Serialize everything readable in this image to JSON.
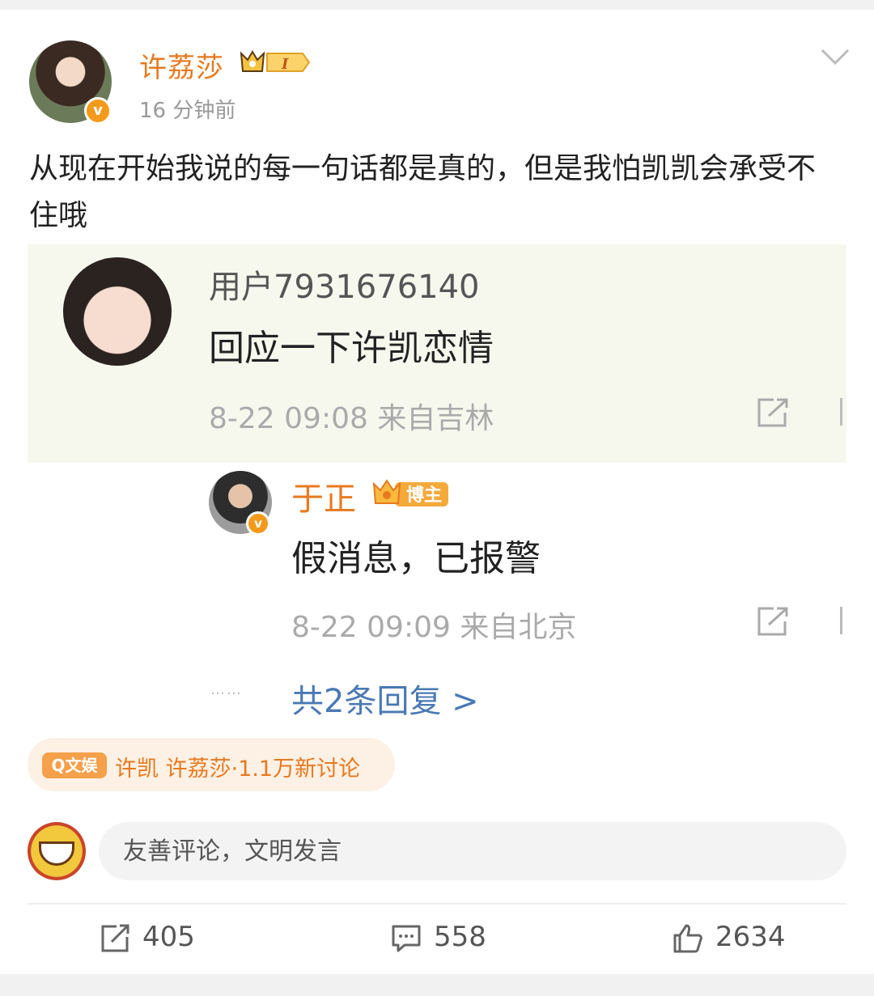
{
  "post": {
    "author": "许荔莎",
    "vip_level": "I",
    "time": "16 分钟前",
    "verified_mark": "v",
    "text": "从现在开始我说的每一句话都是真的，但是我怕凯凯会承受不住哦"
  },
  "screenshot": {
    "comment": {
      "user": "用户7931676140",
      "text": "回应一下许凯恋情",
      "meta": "8-22 09:08  来自吉林"
    },
    "reply": {
      "user": "于正",
      "badge": "博主",
      "verified_mark": "v",
      "text": "假消息，已报警",
      "meta": "8-22 09:09  来自北京"
    },
    "dots": "……",
    "more": "共2条回复 >"
  },
  "topic": {
    "tag": "Q文娱",
    "text": "许凯 许荔莎·1.1万新讨论"
  },
  "comment_input": {
    "placeholder": "友善评论，文明发言"
  },
  "actions": {
    "repost": "405",
    "comment": "558",
    "like": "2634"
  },
  "icons": [
    "chevron-down-icon",
    "share-icon",
    "repost-icon",
    "comment-icon",
    "like-icon",
    "verified-icon",
    "vip-crown-icon"
  ],
  "colors": {
    "accent": "#e8791e",
    "link": "#4a79b4",
    "verified": "#f39a1c"
  }
}
